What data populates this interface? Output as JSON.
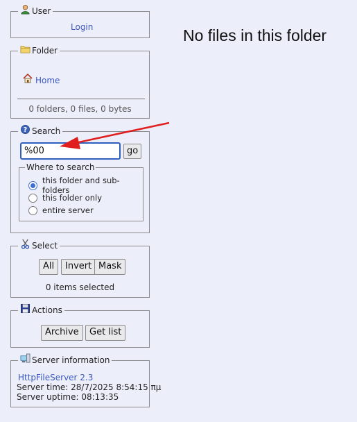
{
  "main_message": "No files in this folder",
  "user_panel": {
    "title": "User",
    "login_label": "Login"
  },
  "folder_panel": {
    "title": "Folder",
    "home_label": "Home",
    "summary": "0 folders, 0 files, 0 bytes"
  },
  "search_panel": {
    "title": "Search",
    "query_value": "%00",
    "go_label": "go",
    "where_title": "Where to search",
    "options": [
      {
        "label": "this folder and sub-folders",
        "selected": true
      },
      {
        "label": "this folder only",
        "selected": false
      },
      {
        "label": "entire server",
        "selected": false
      }
    ]
  },
  "select_panel": {
    "title": "Select",
    "all_label": "All",
    "invert_label": "Invert",
    "mask_label": "Mask",
    "status": "0 items selected"
  },
  "actions_panel": {
    "title": "Actions",
    "archive_label": "Archive",
    "getlist_label": "Get list"
  },
  "server_panel": {
    "title": "Server information",
    "software_link": "HttpFileServer 2.3",
    "server_time": "Server time: 28/7/2025 8:54:15 πμ",
    "server_uptime": "Server uptime: 08:13:35"
  },
  "colors": {
    "accent": "#3f6dd1",
    "link": "#3d58c0",
    "arrow": "#e01e1e",
    "background": "#eceffa"
  }
}
